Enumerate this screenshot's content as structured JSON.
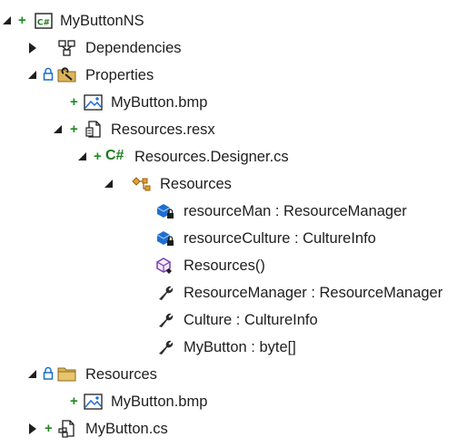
{
  "tree": {
    "project_label": "MyButtonNS",
    "project_icon_text": "C#",
    "dependencies_label": "Dependencies",
    "properties_label": "Properties",
    "properties_bmp_label": "MyButton.bmp",
    "resx_label": "Resources.resx",
    "designer_cs_label": "Resources.Designer.cs",
    "designer_icon_text": "C#",
    "class_label": "Resources",
    "members": [
      "resourceMan : ResourceManager",
      "resourceCulture : CultureInfo",
      "Resources()",
      "ResourceManager : ResourceManager",
      "Culture : CultureInfo",
      "MyButton : byte[]"
    ],
    "resources_folder_label": "Resources",
    "resources_bmp_label": "MyButton.bmp",
    "mybutton_cs_label": "MyButton.cs",
    "added_glyph": "+"
  },
  "colors": {
    "added": "#1e8a1e",
    "lock": "#1a6fc9",
    "folder": "#c8a14a",
    "csharp": "#1e7a1e",
    "field": "#1f6fd1",
    "method": "#7a3fb8",
    "property": "#2d2d2d"
  }
}
